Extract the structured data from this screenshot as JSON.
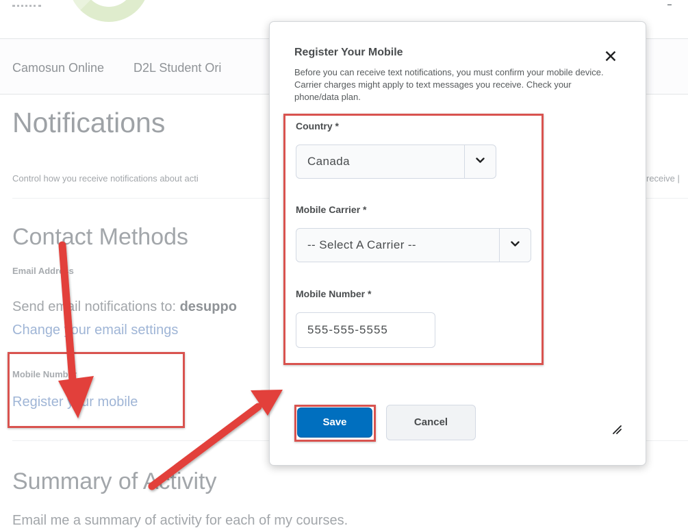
{
  "background": {
    "nav": [
      "Camosun Online",
      "D2L Student Ori"
    ],
    "page_title": "Notifications",
    "description": "Control how you receive notifications about acti",
    "description_right": "receive |",
    "contact": {
      "heading": "Contact Methods",
      "email_label": "Email Address",
      "email_text_prefix": "Send email notifications to: ",
      "email_text_bold": "desuppo",
      "email_link": "Change your email settings",
      "mobile_label": "Mobile Number",
      "mobile_link": "Register your mobile"
    },
    "summary": {
      "heading": "Summary of Activity",
      "text": "Email me a summary of activity for each of my courses."
    }
  },
  "modal": {
    "title": "Register Your Mobile",
    "description": "Before you can receive text notifications, you must confirm your mobile device. Carrier charges might apply to text messages you receive. Check your phone/data plan.",
    "close_label": "✕",
    "country": {
      "label": "Country *",
      "value": "Canada"
    },
    "carrier": {
      "label": "Mobile Carrier *",
      "value": "-- Select A Carrier --"
    },
    "number": {
      "label": "Mobile Number *",
      "value": "555-555-5555"
    },
    "save_label": "Save",
    "cancel_label": "Cancel"
  },
  "colors": {
    "primary": "#006fbf",
    "annotation": "#d9534f"
  }
}
